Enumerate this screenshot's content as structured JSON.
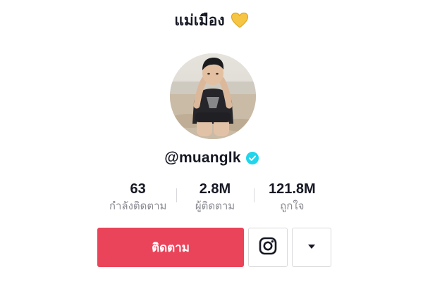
{
  "header": {
    "title": "แม่เมือง",
    "emoji_icon": "yellow-heart-icon",
    "emoji_color": "#f6c544"
  },
  "profile": {
    "avatar_icon": "profile-avatar",
    "username": "@muanglk",
    "verified_icon": "verified-badge-icon",
    "verified_color": "#20d5ec"
  },
  "stats": [
    {
      "value": "63",
      "label": "กำลังติดตาม"
    },
    {
      "value": "2.8M",
      "label": "ผู้ติดตาม"
    },
    {
      "value": "121.8M",
      "label": "ถูกใจ"
    }
  ],
  "actions": {
    "follow_label": "ติดตาม",
    "follow_color": "#ea445a",
    "instagram_icon": "instagram-icon",
    "more_icon": "caret-down-icon"
  }
}
